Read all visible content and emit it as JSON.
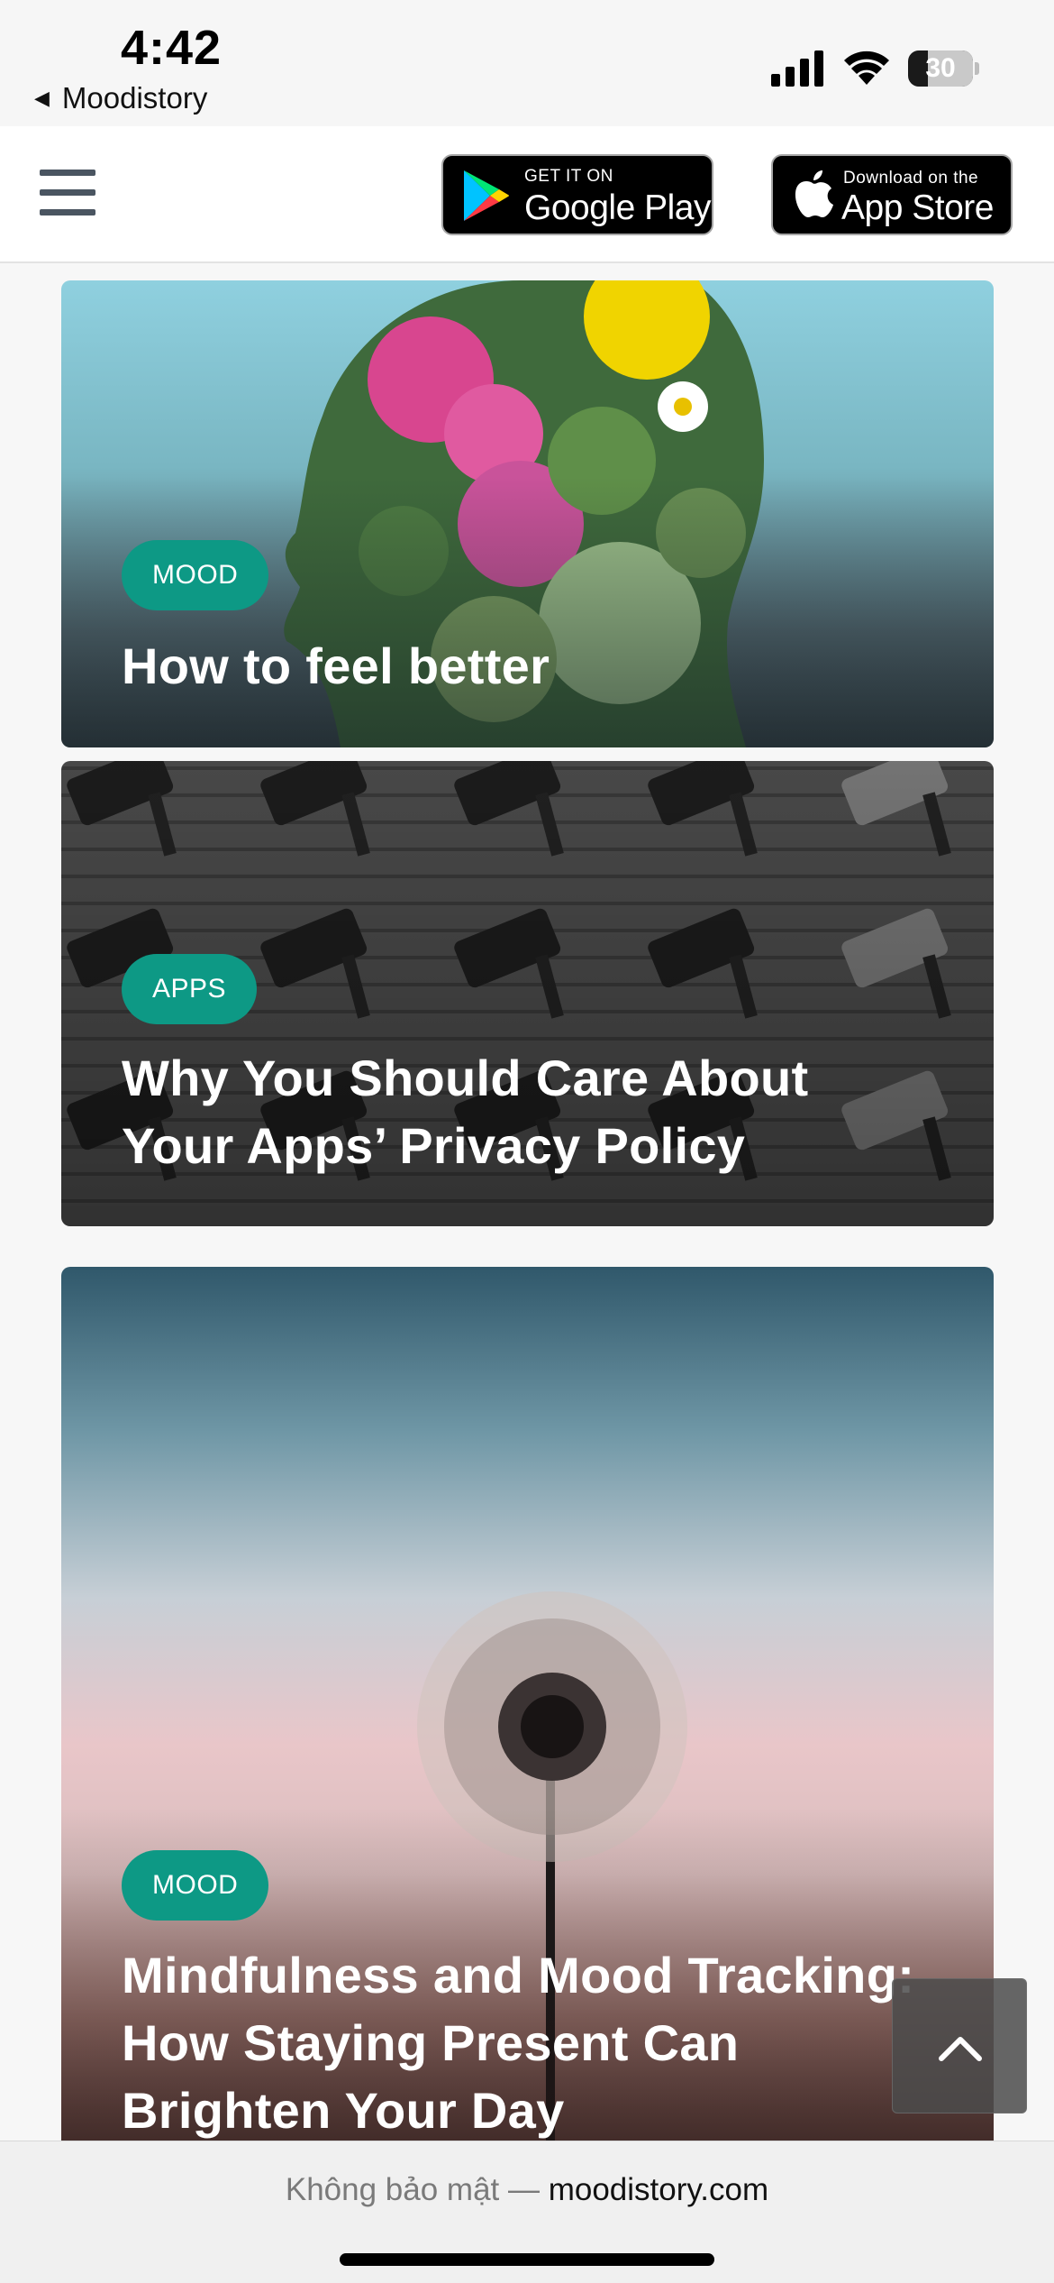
{
  "status_bar": {
    "time": "4:42",
    "back_app": "Moodistory",
    "battery_level": "30",
    "battery_fraction": 0.3
  },
  "header": {
    "google_play": {
      "small": "GET IT ON",
      "big": "Google Play"
    },
    "app_store": {
      "small": "Download on the",
      "big": "App Store"
    }
  },
  "articles": [
    {
      "tag": "MOOD",
      "title": "How to feel better"
    },
    {
      "tag": "APPS",
      "title": "Why You Should Care About Your Apps’ Privacy Policy"
    },
    {
      "tag": "MOOD",
      "title": "Mindfulness and Mood Tracking: How Staying Present Can Brighten Your Day"
    }
  ],
  "browser_bar": {
    "security_text": "Không bảo mật — ",
    "domain": "moodistory.com"
  },
  "colors": {
    "tag_bg": "#0d9985",
    "header_bg": "#ffffff",
    "page_bg": "#f7f7f7"
  },
  "icons": [
    "back-triangle-icon",
    "cellular-signal-icon",
    "wifi-icon",
    "battery-icon",
    "hamburger-menu-icon",
    "google-play-logo-icon",
    "apple-logo-icon",
    "chevron-up-icon"
  ]
}
